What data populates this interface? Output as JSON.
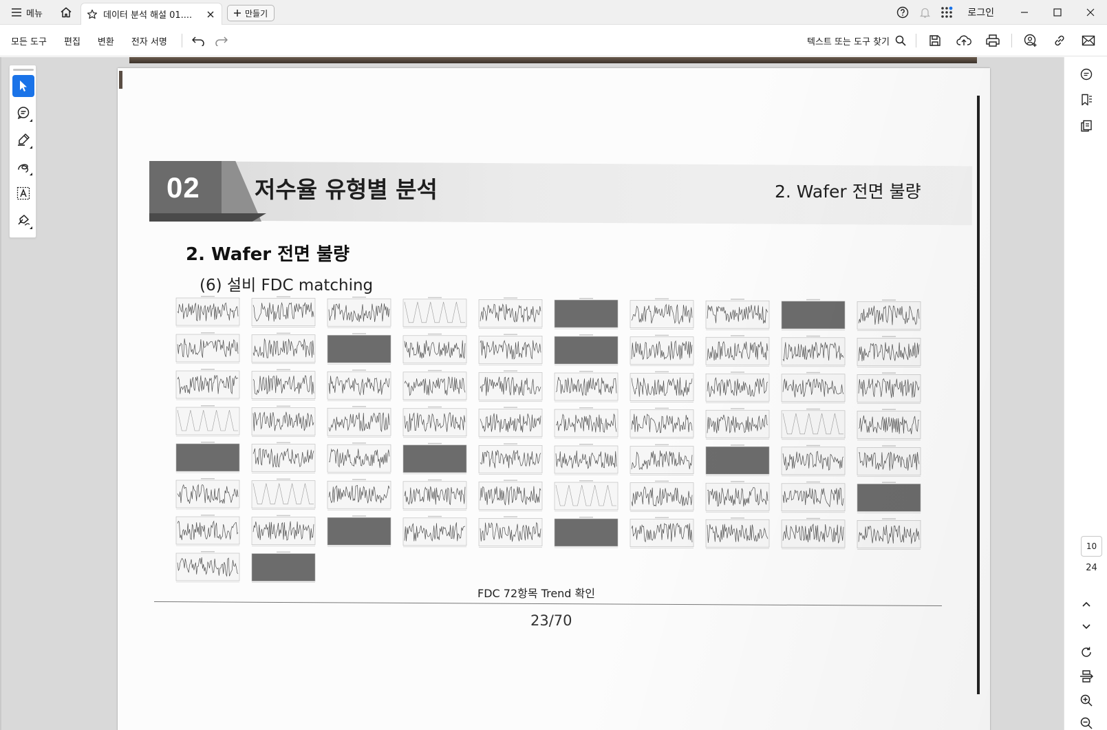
{
  "titlebar": {
    "menu_label": "메뉴",
    "tab_title": "데이터 분석 해설 01....",
    "create_label": "만들기",
    "login_label": "로그인"
  },
  "toolbar": {
    "menu_items": [
      "모든 도구",
      "편집",
      "변환",
      "전자 서명"
    ],
    "find_label": "텍스트 또는 도구 찾기"
  },
  "document": {
    "section_number": "02",
    "section_title": "저수율 유형별 분석",
    "section_subtitle": "2. Wafer 전면 불량",
    "heading": "2. Wafer 전면 불량",
    "subheading": "(6) 설비 FDC matching",
    "caption": "FDC 72항목 Trend 확인",
    "page_footer": "23/70",
    "trend_grid": {
      "count": 72,
      "columns": 10,
      "solid_indices": [
        5,
        8,
        12,
        15,
        40,
        43,
        47,
        59,
        62,
        65,
        71
      ],
      "sparse_indices": [
        3,
        30,
        38,
        51,
        55
      ]
    }
  },
  "navigation": {
    "current_page": "10",
    "total_pages": "24"
  },
  "colors": {
    "accent": "#1a73e8",
    "titlebar_bg": "#f0f0f0",
    "workspace_bg": "#d9d9d9",
    "band_dark": "#6b6b6b"
  }
}
